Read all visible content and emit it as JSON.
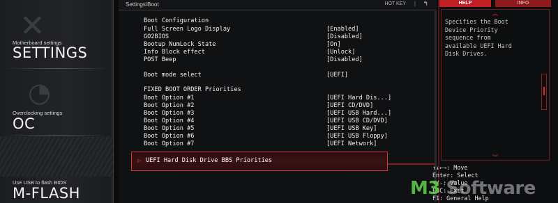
{
  "sidebar": {
    "items": [
      {
        "subtitle": "Motherboard settings",
        "title": "SETTINGS",
        "icon": "wrench-screwdriver-icon"
      },
      {
        "subtitle": "Overclocking settings",
        "title": "OC",
        "icon": "gauge-icon"
      },
      {
        "subtitle": "Use USB to flash BIOS",
        "title": "M-FLASH",
        "icon": "usb-flash-icon"
      }
    ]
  },
  "header": {
    "breadcrumb": "Settings\\Boot",
    "hotkey_label": "HOT KEY",
    "separator": "|",
    "back_symbol": "↰"
  },
  "boot_configuration": {
    "section_title": "Boot Configuration",
    "options": [
      {
        "label": "Full Screen Logo Display",
        "value": "[Enabled]"
      },
      {
        "label": "GO2BIOS",
        "value": "[Disabled]"
      },
      {
        "label": "Bootup NumLock State",
        "value": "[On]"
      },
      {
        "label": "Info Block effect",
        "value": "[Unlock]"
      },
      {
        "label": "POST Beep",
        "value": "[Disabled]"
      }
    ]
  },
  "boot_mode": {
    "label": "Boot mode select",
    "value": "[UEFI]"
  },
  "fixed_boot_order": {
    "section_title": "FIXED BOOT ORDER Priorities",
    "options": [
      {
        "label": "Boot Option #1",
        "value": "[UEFI Hard Dis...]"
      },
      {
        "label": "Boot Option #2",
        "value": "[UEFI CD/DVD]"
      },
      {
        "label": "Boot Option #3",
        "value": "[UEFI USB Hard...]"
      },
      {
        "label": "Boot Option #4",
        "value": "[UEFI USB CD/DVD]"
      },
      {
        "label": "Boot Option #5",
        "value": "[UEFI USB Key]"
      },
      {
        "label": "Boot Option #6",
        "value": "[UEFI USB Floppy]"
      },
      {
        "label": "Boot Option #7",
        "value": "[UEFI Network]"
      }
    ]
  },
  "selected_item": {
    "label": "UEFI Hard Disk Drive BBS Priorities",
    "arrow": "▷"
  },
  "help_panel": {
    "tab_help": "HELP",
    "tab_info": "INFO",
    "description": "Specifies the Boot\nDevice Priority\nsequence from\navailable UEFI Hard\nDisk Drives.",
    "key_hints": [
      "↑↓←→: Move",
      "Enter: Select",
      "+/-: Value",
      "ESC: Exit",
      "F1: General Help"
    ]
  },
  "watermark": {
    "prefix": "M3",
    "suffix": " Software"
  },
  "colors": {
    "accent": "#c32025",
    "background": "#0b0b0c",
    "selection_border": "#d23a3a"
  }
}
